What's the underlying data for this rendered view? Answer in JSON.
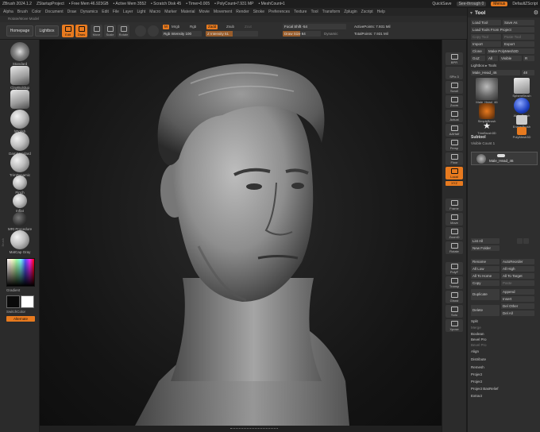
{
  "titlebar": {
    "app": "ZBrush 2024.1.2",
    "project": "ZStartupProject",
    "free_mem": "• Free Mem 46.923GB",
    "active_mem": "• Active Mem 3552",
    "scratch": "• Scratch Disk 45",
    "timer": "• Timer•0.005",
    "polycount": "• PolyCount•7.931 MP",
    "meshcount": "• MeshCount•1",
    "quicksave": "QuickSave",
    "see_through": "See-through 0",
    "menus": "Menus",
    "default_script": "DefaultZScript"
  },
  "menubar": [
    "Alpha",
    "Brush",
    "Color",
    "Document",
    "Draw",
    "Dynamics",
    "Edit",
    "File",
    "Layer",
    "Light",
    "Macro",
    "Marker",
    "Material",
    "Movie",
    "Movement",
    "Render",
    "Stroke",
    "Preferences",
    "Texture",
    "Tool",
    "Transform",
    "Zplugin",
    "Zscript",
    "Help"
  ],
  "subbar": "Rotate/Move Model",
  "shelf": {
    "homepage": "Homepage",
    "lightbox": "Lightbox",
    "buttons": [
      {
        "label": "Edit",
        "state": "on"
      },
      {
        "label": "Draw",
        "state": "on"
      },
      {
        "label": "Move",
        "state": "off"
      },
      {
        "label": "Scale",
        "state": "off"
      },
      {
        "label": "Rotate",
        "state": "off"
      }
    ],
    "mrgb": "M",
    "mrgb_b": "Mrgb",
    "rgb": "Rgb",
    "rgb_intensity": "Rgb Intensity 100",
    "zadd": "Zadd",
    "zsub": "Zsub",
    "zcut": "Zcut",
    "z_intensity": "Z Intensity 51",
    "focal_shift": "Focal Shift -54",
    "draw_size": "Draw Size 64",
    "dynamic": "Dynamic",
    "active_points": "ActivePoints: 7.931 Mil",
    "total_points": "TotalPoints: 7.931 Mil"
  },
  "left": {
    "brushes": [
      "Standard",
      "ClayBuildup",
      "Move",
      "hPolish",
      "DamStandard",
      "TrimDynamic",
      "Pinch",
      "Inflat",
      "MRt Procedure",
      "MatCap Gray"
    ],
    "gradient_label": "Gradient",
    "switch_color": "SwitchColor",
    "alternate": "Alternate",
    "side_text": "Brush"
  },
  "right_shelf": [
    "BPR",
    "SPix 3",
    "Scroll",
    "Zoom",
    "Actual",
    "AAHalf",
    "Persp",
    "Floor",
    "Local",
    "XYZ",
    "Frame",
    "Move",
    "ZoomD",
    "Rotate",
    "PolyF",
    "Transp",
    "Ghost",
    "Solo",
    "Xpose"
  ],
  "tool": {
    "title": "Tool",
    "load_tool": "Load Tool",
    "save_as": "Save As",
    "load_tools_from_project": "Load Tools From Project",
    "copy_tool": "Copy Tool",
    "paste_tool": "Paste Tool",
    "import": "Import",
    "export": "Export",
    "clone": "Clone",
    "make_polymesh": "Make PolyMesh3D",
    "goz": "GoZ",
    "all": "All",
    "visible": "Visible",
    "r": "R",
    "lightbox_tools": "Lightbox ▸ Tools",
    "current_tool": "Male_Head_46",
    "current_tool_count": "48",
    "thumbs": [
      "Male_Head_46",
      "SphereBrush",
      "SimpleBrush",
      "AlphaBrush",
      "SimpleBrush",
      "EraserBrush",
      "TrimBrush3D",
      "PolyMesh3D"
    ],
    "subtool": "Subtool",
    "visible_count": "Visible Count 1",
    "subtool_name": "Male_Head_46",
    "list_all": "List All",
    "new_folder": "New Folder",
    "rename": "Rename",
    "auto_reorder": "AutoReorder",
    "all_low": "All Low",
    "all_high": "All High",
    "all_to_home": "All To Home",
    "all_to_target": "All To Target",
    "copy": "Copy",
    "paste": "Paste",
    "duplicate": "Duplicate",
    "append": "Append",
    "insert": "Insert",
    "delete": "Delete",
    "del_other": "Del Other",
    "del_all": "Del All",
    "list": [
      "Split",
      "Merge",
      "Boolean",
      "Bevel Pro",
      "Bevel Pro",
      "Align",
      "Distribute",
      "Remesh",
      "Project",
      "Project",
      "Project BasRelief",
      "Extract"
    ]
  }
}
